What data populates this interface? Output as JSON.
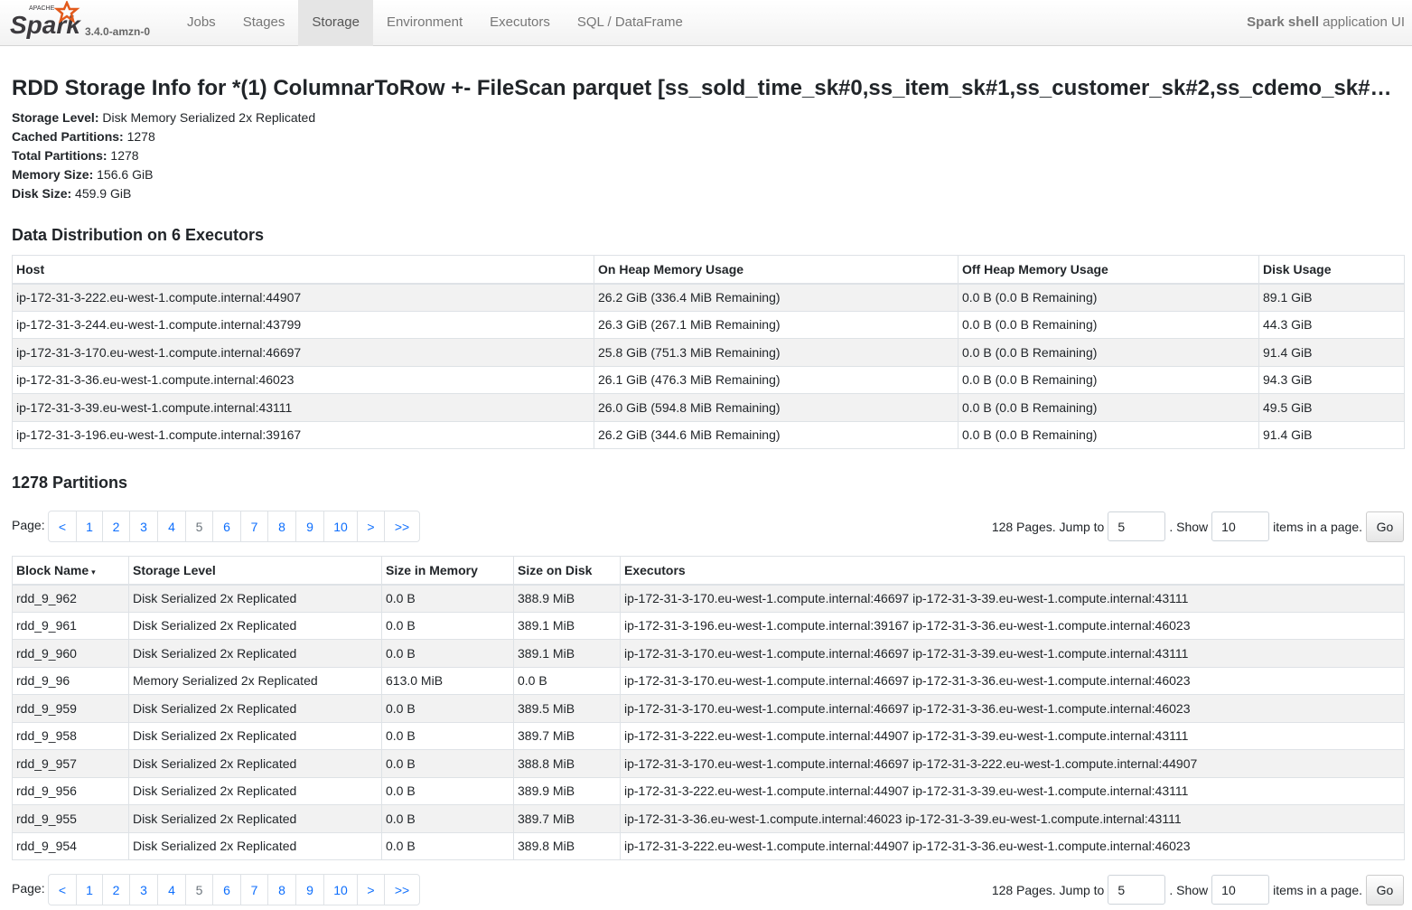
{
  "navbar": {
    "logo_text": "Spark",
    "logo_super": "APACHE",
    "version": "3.4.0-amzn-0",
    "tabs": [
      {
        "label": "Jobs",
        "active": false
      },
      {
        "label": "Stages",
        "active": false
      },
      {
        "label": "Storage",
        "active": true
      },
      {
        "label": "Environment",
        "active": false
      },
      {
        "label": "Executors",
        "active": false
      },
      {
        "label": "SQL / DataFrame",
        "active": false
      }
    ],
    "app_name": "Spark shell",
    "app_suffix": "application UI"
  },
  "page": {
    "title": "RDD Storage Info for *(1) ColumnarToRow +- FileScan parquet [ss_sold_time_sk#0,ss_item_sk#1,ss_customer_sk#2,ss_cdemo_sk#…"
  },
  "summary": [
    {
      "label": "Storage Level:",
      "value": "Disk Memory Serialized 2x Replicated"
    },
    {
      "label": "Cached Partitions:",
      "value": "1278"
    },
    {
      "label": "Total Partitions:",
      "value": "1278"
    },
    {
      "label": "Memory Size:",
      "value": "156.6 GiB"
    },
    {
      "label": "Disk Size:",
      "value": "459.9 GiB"
    }
  ],
  "distribution": {
    "title": "Data Distribution on 6 Executors",
    "headers": [
      "Host",
      "On Heap Memory Usage",
      "Off Heap Memory Usage",
      "Disk Usage"
    ],
    "rows": [
      [
        "ip-172-31-3-222.eu-west-1.compute.internal:44907",
        "26.2 GiB (336.4 MiB Remaining)",
        "0.0 B (0.0 B Remaining)",
        "89.1 GiB"
      ],
      [
        "ip-172-31-3-244.eu-west-1.compute.internal:43799",
        "26.3 GiB (267.1 MiB Remaining)",
        "0.0 B (0.0 B Remaining)",
        "44.3 GiB"
      ],
      [
        "ip-172-31-3-170.eu-west-1.compute.internal:46697",
        "25.8 GiB (751.3 MiB Remaining)",
        "0.0 B (0.0 B Remaining)",
        "91.4 GiB"
      ],
      [
        "ip-172-31-3-36.eu-west-1.compute.internal:46023",
        "26.1 GiB (476.3 MiB Remaining)",
        "0.0 B (0.0 B Remaining)",
        "94.3 GiB"
      ],
      [
        "ip-172-31-3-39.eu-west-1.compute.internal:43111",
        "26.0 GiB (594.8 MiB Remaining)",
        "0.0 B (0.0 B Remaining)",
        "49.5 GiB"
      ],
      [
        "ip-172-31-3-196.eu-west-1.compute.internal:39167",
        "26.2 GiB (344.6 MiB Remaining)",
        "0.0 B (0.0 B Remaining)",
        "91.4 GiB"
      ]
    ]
  },
  "partitions": {
    "title": "1278 Partitions",
    "pager": {
      "label": "Page:",
      "items": [
        "<",
        "1",
        "2",
        "3",
        "4",
        "5",
        "6",
        "7",
        "8",
        "9",
        "10",
        ">",
        ">>"
      ],
      "current": "5",
      "pages_text": "128 Pages. Jump to",
      "jump_value": "5",
      "show_text": ". Show",
      "show_value": "10",
      "items_text": "items in a page.",
      "go_label": "Go"
    },
    "headers": [
      "Block Name",
      "Storage Level",
      "Size in Memory",
      "Size on Disk",
      "Executors"
    ],
    "sort_indicator": "▾",
    "rows": [
      [
        "rdd_9_962",
        "Disk Serialized 2x Replicated",
        "0.0 B",
        "388.9 MiB",
        "ip-172-31-3-170.eu-west-1.compute.internal:46697 ip-172-31-3-39.eu-west-1.compute.internal:43111"
      ],
      [
        "rdd_9_961",
        "Disk Serialized 2x Replicated",
        "0.0 B",
        "389.1 MiB",
        "ip-172-31-3-196.eu-west-1.compute.internal:39167 ip-172-31-3-36.eu-west-1.compute.internal:46023"
      ],
      [
        "rdd_9_960",
        "Disk Serialized 2x Replicated",
        "0.0 B",
        "389.1 MiB",
        "ip-172-31-3-170.eu-west-1.compute.internal:46697 ip-172-31-3-39.eu-west-1.compute.internal:43111"
      ],
      [
        "rdd_9_96",
        "Memory Serialized 2x Replicated",
        "613.0 MiB",
        "0.0 B",
        "ip-172-31-3-170.eu-west-1.compute.internal:46697 ip-172-31-3-36.eu-west-1.compute.internal:46023"
      ],
      [
        "rdd_9_959",
        "Disk Serialized 2x Replicated",
        "0.0 B",
        "389.5 MiB",
        "ip-172-31-3-170.eu-west-1.compute.internal:46697 ip-172-31-3-36.eu-west-1.compute.internal:46023"
      ],
      [
        "rdd_9_958",
        "Disk Serialized 2x Replicated",
        "0.0 B",
        "389.7 MiB",
        "ip-172-31-3-222.eu-west-1.compute.internal:44907 ip-172-31-3-39.eu-west-1.compute.internal:43111"
      ],
      [
        "rdd_9_957",
        "Disk Serialized 2x Replicated",
        "0.0 B",
        "388.8 MiB",
        "ip-172-31-3-170.eu-west-1.compute.internal:46697 ip-172-31-3-222.eu-west-1.compute.internal:44907"
      ],
      [
        "rdd_9_956",
        "Disk Serialized 2x Replicated",
        "0.0 B",
        "389.9 MiB",
        "ip-172-31-3-222.eu-west-1.compute.internal:44907 ip-172-31-3-39.eu-west-1.compute.internal:43111"
      ],
      [
        "rdd_9_955",
        "Disk Serialized 2x Replicated",
        "0.0 B",
        "389.7 MiB",
        "ip-172-31-3-36.eu-west-1.compute.internal:46023 ip-172-31-3-39.eu-west-1.compute.internal:43111"
      ],
      [
        "rdd_9_954",
        "Disk Serialized 2x Replicated",
        "0.0 B",
        "389.8 MiB",
        "ip-172-31-3-222.eu-west-1.compute.internal:44907 ip-172-31-3-36.eu-west-1.compute.internal:46023"
      ]
    ]
  },
  "colors": {
    "link": "#0d6efd",
    "logo_orange": "#e25a1c",
    "logo_dark": "#3c3a3e"
  }
}
